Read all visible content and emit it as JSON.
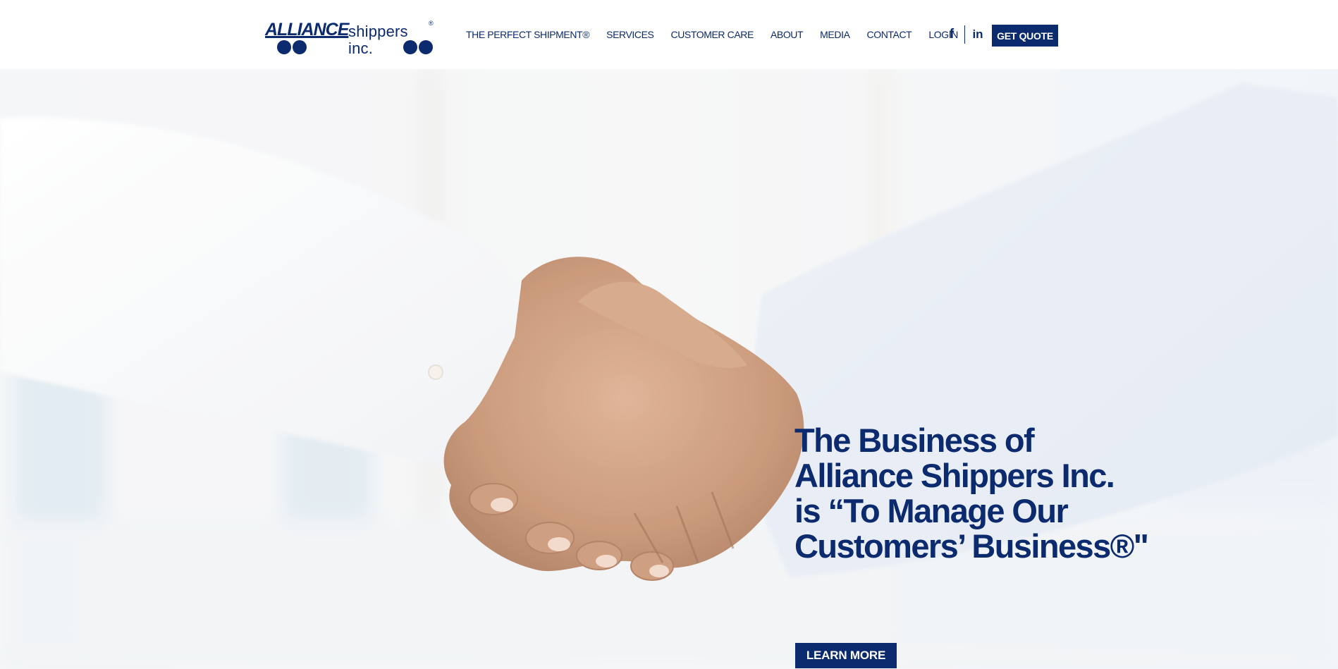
{
  "brand": {
    "logo_word": "ALLIANCE",
    "logo_sub": "shippers inc.",
    "logo_reg": "®",
    "color": "#0c2a6e"
  },
  "nav": {
    "items": [
      {
        "label": "THE PERFECT SHIPMENT®"
      },
      {
        "label": "SERVICES"
      },
      {
        "label": "CUSTOMER CARE"
      },
      {
        "label": "ABOUT"
      },
      {
        "label": "MEDIA"
      },
      {
        "label": "CONTACT"
      },
      {
        "label": "LOGIN"
      }
    ]
  },
  "social": {
    "facebook_glyph": "f",
    "linkedin_glyph": "in",
    "icons": [
      "facebook-icon",
      "linkedin-icon"
    ]
  },
  "header": {
    "quote_label": "GET QUOTE"
  },
  "hero": {
    "headline_lines": [
      "The Business of",
      "Alliance Shippers Inc.",
      "is “To Manage Our",
      "Customers’ Business®\""
    ],
    "cta_label": "LEARN MORE",
    "image": "handshake-photo"
  }
}
